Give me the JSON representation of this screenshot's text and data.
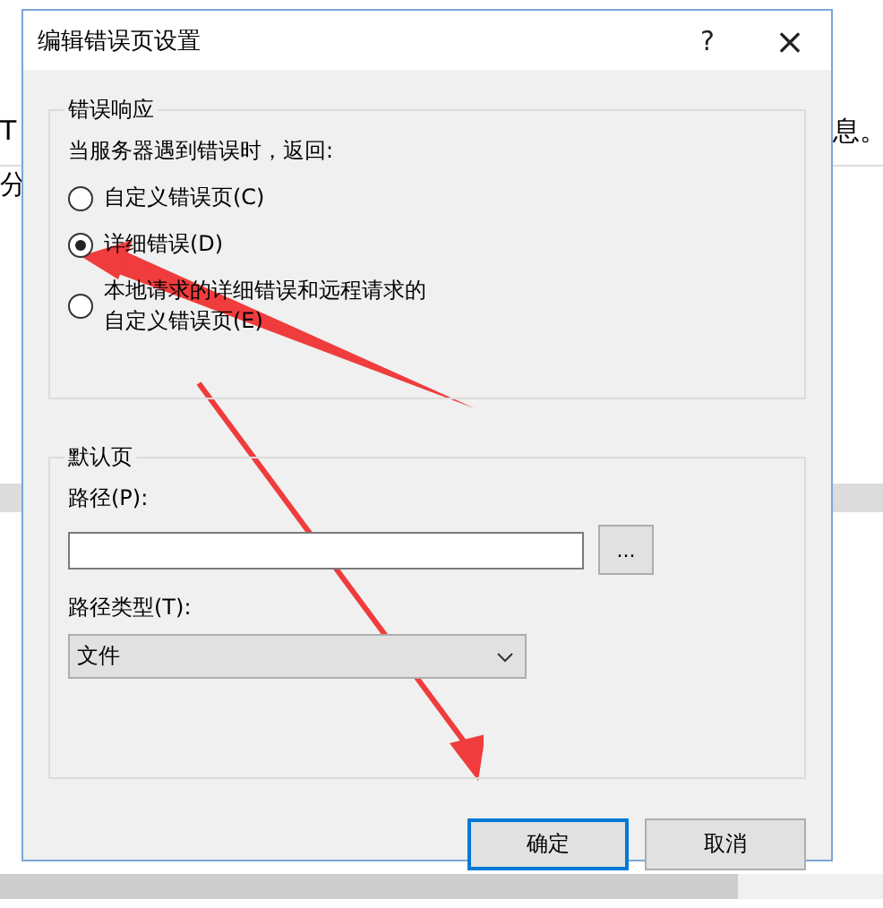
{
  "background": {
    "left_texts": [
      "T",
      "分"
    ],
    "right_text": "息。"
  },
  "dialog": {
    "title": "编辑错误页设置",
    "help": "?",
    "close": "×",
    "error_response": {
      "legend": "错误响应",
      "prompt": "当服务器遇到错误时，返回:",
      "options": [
        {
          "lines": [
            "自定义错误页(C)"
          ],
          "selected": false
        },
        {
          "lines": [
            "详细错误(D)"
          ],
          "selected": true
        },
        {
          "lines": [
            "本地请求的详细错误和远程请求的",
            "自定义错误页(E)"
          ],
          "selected": false
        }
      ]
    },
    "default_page": {
      "legend": "默认页",
      "path_label": "路径(P):",
      "browse": "...",
      "path_type_label": "路径类型(T):",
      "path_type": "文件"
    },
    "buttons": [
      {
        "label": "确定",
        "selected": true
      },
      {
        "label": "取消",
        "selected": false
      }
    ]
  }
}
